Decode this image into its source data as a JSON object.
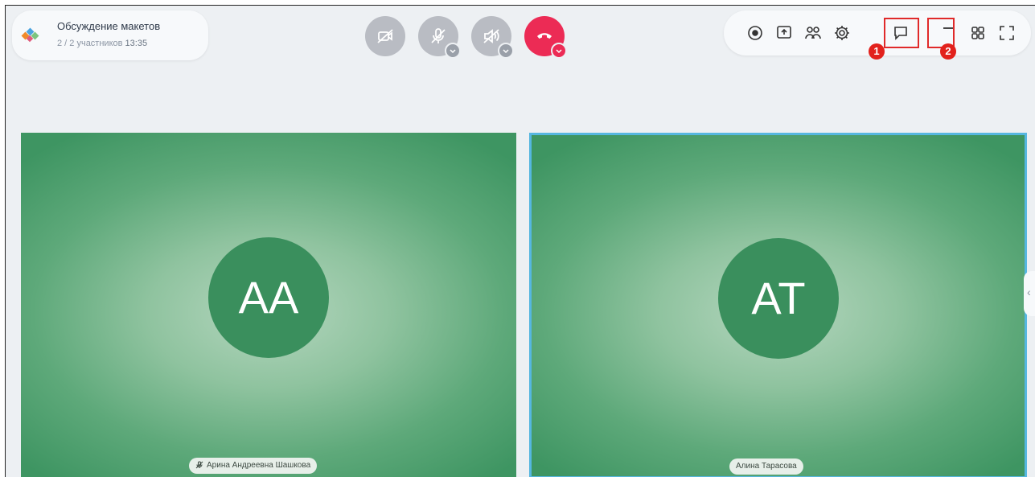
{
  "meeting": {
    "title": "Обсуждение макетов",
    "participants": "2 / 2 участников",
    "time": "13:35"
  },
  "call_controls": [
    {
      "name": "camera-off-button",
      "icon": "camera-off-icon",
      "state": "off"
    },
    {
      "name": "microphone-off-button",
      "icon": "microphone-off-icon",
      "state": "off"
    },
    {
      "name": "speaker-off-button",
      "icon": "speaker-off-icon",
      "state": "off"
    },
    {
      "name": "hang-up-button",
      "icon": "phone-hangup-icon",
      "color": "#ec2b55"
    }
  ],
  "toolbar": [
    {
      "name": "record-button",
      "icon": "record-icon"
    },
    {
      "name": "screen-share-button",
      "icon": "screen-share-icon"
    },
    {
      "name": "participants-button",
      "icon": "participants-icon"
    },
    {
      "name": "settings-button",
      "icon": "gear-icon"
    },
    {
      "name": "chat-button",
      "icon": "chat-icon",
      "highlighted": true,
      "marker": "1"
    },
    {
      "name": "minimize-button",
      "icon": "minimize-icon",
      "highlighted": true,
      "marker": "2"
    },
    {
      "name": "layout-grid-button",
      "icon": "grid-icon"
    },
    {
      "name": "fullscreen-button",
      "icon": "fullscreen-icon"
    }
  ],
  "markers": {
    "one": "1",
    "two": "2"
  },
  "participants": [
    {
      "initials": "АА",
      "name": "Арина Андреевна Шашкова",
      "muted": true
    },
    {
      "initials": "АТ",
      "name": "Алина Тарасова",
      "active_speaker": true
    }
  ],
  "side_panel": {
    "toggle_icon": "chevron-left-icon"
  },
  "colors": {
    "background": "#edf0f3",
    "tile_green": "#5ea97a",
    "avatar_green": "#3a8f5d",
    "active_border": "#56b7e0",
    "highlight_red": "#e02a2a"
  }
}
